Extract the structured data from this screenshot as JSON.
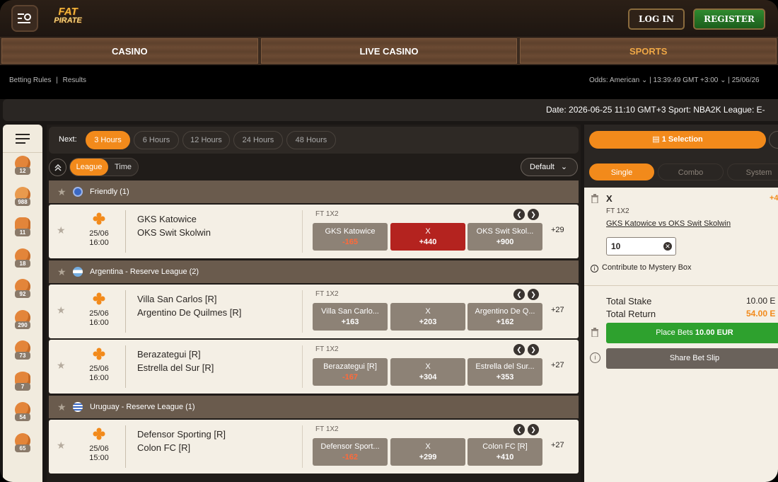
{
  "header": {
    "logo_line1": "FAT",
    "logo_line2": "PIRATE",
    "login_label": "LOG IN",
    "register_label": "REGISTER"
  },
  "nav": {
    "tabs": [
      {
        "label": "CASINO",
        "active": false
      },
      {
        "label": "LIVE CASINO",
        "active": false
      },
      {
        "label": "SPORTS",
        "active": true
      }
    ]
  },
  "subbar": {
    "betting_rules": "Betting Rules",
    "separator": "|",
    "results": "Results",
    "odds_label": "Odds:",
    "odds_value": "American",
    "time": "13:39:49 GMT +3:00",
    "date": "25/06/26"
  },
  "ticker": {
    "text": "Date: 2026-06-25 11:10 GMT+3 Sport: NBA2K League: E-"
  },
  "sidebar": {
    "sports": [
      {
        "icon": "basketball-icon",
        "count": "12"
      },
      {
        "icon": "football-icon",
        "count": "988"
      },
      {
        "icon": "baseball-icon",
        "count": "11"
      },
      {
        "icon": "basketball-icon",
        "count": "18"
      },
      {
        "icon": "volleyball-icon",
        "count": "92"
      },
      {
        "icon": "handball-icon",
        "count": "290"
      },
      {
        "icon": "tennis-icon",
        "count": "73"
      },
      {
        "icon": "american-football-icon",
        "count": "7"
      },
      {
        "icon": "badminton-icon",
        "count": "54"
      },
      {
        "icon": "boxing-icon",
        "count": "65"
      }
    ]
  },
  "filters": {
    "next_label": "Next:",
    "hours": [
      "3 Hours",
      "6 Hours",
      "12 Hours",
      "24 Hours",
      "48 Hours"
    ],
    "active_hour": "3 Hours",
    "group_league": "League",
    "group_time": "Time",
    "sort": "Default"
  },
  "leagues": [
    {
      "name": "Friendly (1)",
      "flag": "world-flag-icon"
    },
    {
      "name": "Argentina - Reserve League (2)",
      "flag": "argentina-flag-icon"
    },
    {
      "name": "Uruguay - Reserve League (1)",
      "flag": "uruguay-flag-icon"
    }
  ],
  "matches": [
    {
      "date": "25/06",
      "time": "16:00",
      "home": "GKS Katowice",
      "away": "OKS Swit Skolwin",
      "market": "FT 1X2",
      "odds": [
        {
          "label": "GKS Katowice",
          "price": "-165"
        },
        {
          "label": "X",
          "price": "+440"
        },
        {
          "label": "OKS Swit Skol...",
          "price": "+900"
        }
      ],
      "more": "+29"
    },
    {
      "date": "25/06",
      "time": "16:00",
      "home": "Villa San Carlos [R]",
      "away": "Argentino De Quilmes [R]",
      "market": "FT 1X2",
      "odds": [
        {
          "label": "Villa San Carlo...",
          "price": "+163"
        },
        {
          "label": "X",
          "price": "+203"
        },
        {
          "label": "Argentino De Q...",
          "price": "+162"
        }
      ],
      "more": "+27"
    },
    {
      "date": "25/06",
      "time": "16:00",
      "home": "Berazategui [R]",
      "away": "Estrella del Sur [R]",
      "market": "FT 1X2",
      "odds": [
        {
          "label": "Berazategui [R]",
          "price": "-167"
        },
        {
          "label": "X",
          "price": "+304"
        },
        {
          "label": "Estrella del Sur...",
          "price": "+353"
        }
      ],
      "more": "+27"
    },
    {
      "date": "25/06",
      "time": "15:00",
      "home": "Defensor Sporting [R]",
      "away": "Colon FC [R]",
      "market": "FT 1X2",
      "odds": [
        {
          "label": "Defensor Sport...",
          "price": "-162"
        },
        {
          "label": "X",
          "price": "+299"
        },
        {
          "label": "Colon FC [R]",
          "price": "+410"
        }
      ],
      "more": "+27"
    }
  ],
  "betslip": {
    "selection_btn": "1 Selection",
    "tabs": [
      "Single",
      "Combo",
      "System"
    ],
    "bet_selection": "X",
    "bet_odds": "+4",
    "bet_market": "FT 1X2",
    "bet_match": "GKS Katowice vs OKS Swit Skolwin",
    "stake": "10",
    "contribute": "Contribute to Mystery Box",
    "total_stake_label": "Total Stake",
    "total_stake_value": "10.00 E",
    "total_return_label": "Total Return",
    "total_return_value": "54.00 E",
    "place_bets_prefix": "Place Bets ",
    "place_bets_amount": "10.00 EUR",
    "share_label": "Share Bet Slip"
  },
  "colors": {
    "accent": "#f28a1b",
    "selected_odd": "#b4231f",
    "place_bet": "#2ea12e",
    "negative_price": "#ff6a3a"
  }
}
